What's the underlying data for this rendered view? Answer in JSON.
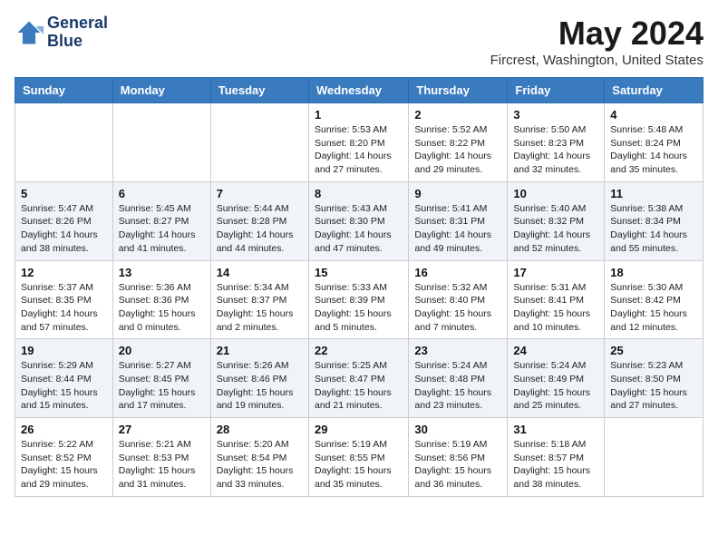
{
  "header": {
    "logo_line1": "General",
    "logo_line2": "Blue",
    "month_title": "May 2024",
    "location": "Fircrest, Washington, United States"
  },
  "days_of_week": [
    "Sunday",
    "Monday",
    "Tuesday",
    "Wednesday",
    "Thursday",
    "Friday",
    "Saturday"
  ],
  "weeks": [
    [
      {
        "num": "",
        "info": ""
      },
      {
        "num": "",
        "info": ""
      },
      {
        "num": "",
        "info": ""
      },
      {
        "num": "1",
        "info": "Sunrise: 5:53 AM\nSunset: 8:20 PM\nDaylight: 14 hours and 27 minutes."
      },
      {
        "num": "2",
        "info": "Sunrise: 5:52 AM\nSunset: 8:22 PM\nDaylight: 14 hours and 29 minutes."
      },
      {
        "num": "3",
        "info": "Sunrise: 5:50 AM\nSunset: 8:23 PM\nDaylight: 14 hours and 32 minutes."
      },
      {
        "num": "4",
        "info": "Sunrise: 5:48 AM\nSunset: 8:24 PM\nDaylight: 14 hours and 35 minutes."
      }
    ],
    [
      {
        "num": "5",
        "info": "Sunrise: 5:47 AM\nSunset: 8:26 PM\nDaylight: 14 hours and 38 minutes."
      },
      {
        "num": "6",
        "info": "Sunrise: 5:45 AM\nSunset: 8:27 PM\nDaylight: 14 hours and 41 minutes."
      },
      {
        "num": "7",
        "info": "Sunrise: 5:44 AM\nSunset: 8:28 PM\nDaylight: 14 hours and 44 minutes."
      },
      {
        "num": "8",
        "info": "Sunrise: 5:43 AM\nSunset: 8:30 PM\nDaylight: 14 hours and 47 minutes."
      },
      {
        "num": "9",
        "info": "Sunrise: 5:41 AM\nSunset: 8:31 PM\nDaylight: 14 hours and 49 minutes."
      },
      {
        "num": "10",
        "info": "Sunrise: 5:40 AM\nSunset: 8:32 PM\nDaylight: 14 hours and 52 minutes."
      },
      {
        "num": "11",
        "info": "Sunrise: 5:38 AM\nSunset: 8:34 PM\nDaylight: 14 hours and 55 minutes."
      }
    ],
    [
      {
        "num": "12",
        "info": "Sunrise: 5:37 AM\nSunset: 8:35 PM\nDaylight: 14 hours and 57 minutes."
      },
      {
        "num": "13",
        "info": "Sunrise: 5:36 AM\nSunset: 8:36 PM\nDaylight: 15 hours and 0 minutes."
      },
      {
        "num": "14",
        "info": "Sunrise: 5:34 AM\nSunset: 8:37 PM\nDaylight: 15 hours and 2 minutes."
      },
      {
        "num": "15",
        "info": "Sunrise: 5:33 AM\nSunset: 8:39 PM\nDaylight: 15 hours and 5 minutes."
      },
      {
        "num": "16",
        "info": "Sunrise: 5:32 AM\nSunset: 8:40 PM\nDaylight: 15 hours and 7 minutes."
      },
      {
        "num": "17",
        "info": "Sunrise: 5:31 AM\nSunset: 8:41 PM\nDaylight: 15 hours and 10 minutes."
      },
      {
        "num": "18",
        "info": "Sunrise: 5:30 AM\nSunset: 8:42 PM\nDaylight: 15 hours and 12 minutes."
      }
    ],
    [
      {
        "num": "19",
        "info": "Sunrise: 5:29 AM\nSunset: 8:44 PM\nDaylight: 15 hours and 15 minutes."
      },
      {
        "num": "20",
        "info": "Sunrise: 5:27 AM\nSunset: 8:45 PM\nDaylight: 15 hours and 17 minutes."
      },
      {
        "num": "21",
        "info": "Sunrise: 5:26 AM\nSunset: 8:46 PM\nDaylight: 15 hours and 19 minutes."
      },
      {
        "num": "22",
        "info": "Sunrise: 5:25 AM\nSunset: 8:47 PM\nDaylight: 15 hours and 21 minutes."
      },
      {
        "num": "23",
        "info": "Sunrise: 5:24 AM\nSunset: 8:48 PM\nDaylight: 15 hours and 23 minutes."
      },
      {
        "num": "24",
        "info": "Sunrise: 5:24 AM\nSunset: 8:49 PM\nDaylight: 15 hours and 25 minutes."
      },
      {
        "num": "25",
        "info": "Sunrise: 5:23 AM\nSunset: 8:50 PM\nDaylight: 15 hours and 27 minutes."
      }
    ],
    [
      {
        "num": "26",
        "info": "Sunrise: 5:22 AM\nSunset: 8:52 PM\nDaylight: 15 hours and 29 minutes."
      },
      {
        "num": "27",
        "info": "Sunrise: 5:21 AM\nSunset: 8:53 PM\nDaylight: 15 hours and 31 minutes."
      },
      {
        "num": "28",
        "info": "Sunrise: 5:20 AM\nSunset: 8:54 PM\nDaylight: 15 hours and 33 minutes."
      },
      {
        "num": "29",
        "info": "Sunrise: 5:19 AM\nSunset: 8:55 PM\nDaylight: 15 hours and 35 minutes."
      },
      {
        "num": "30",
        "info": "Sunrise: 5:19 AM\nSunset: 8:56 PM\nDaylight: 15 hours and 36 minutes."
      },
      {
        "num": "31",
        "info": "Sunrise: 5:18 AM\nSunset: 8:57 PM\nDaylight: 15 hours and 38 minutes."
      },
      {
        "num": "",
        "info": ""
      }
    ]
  ]
}
